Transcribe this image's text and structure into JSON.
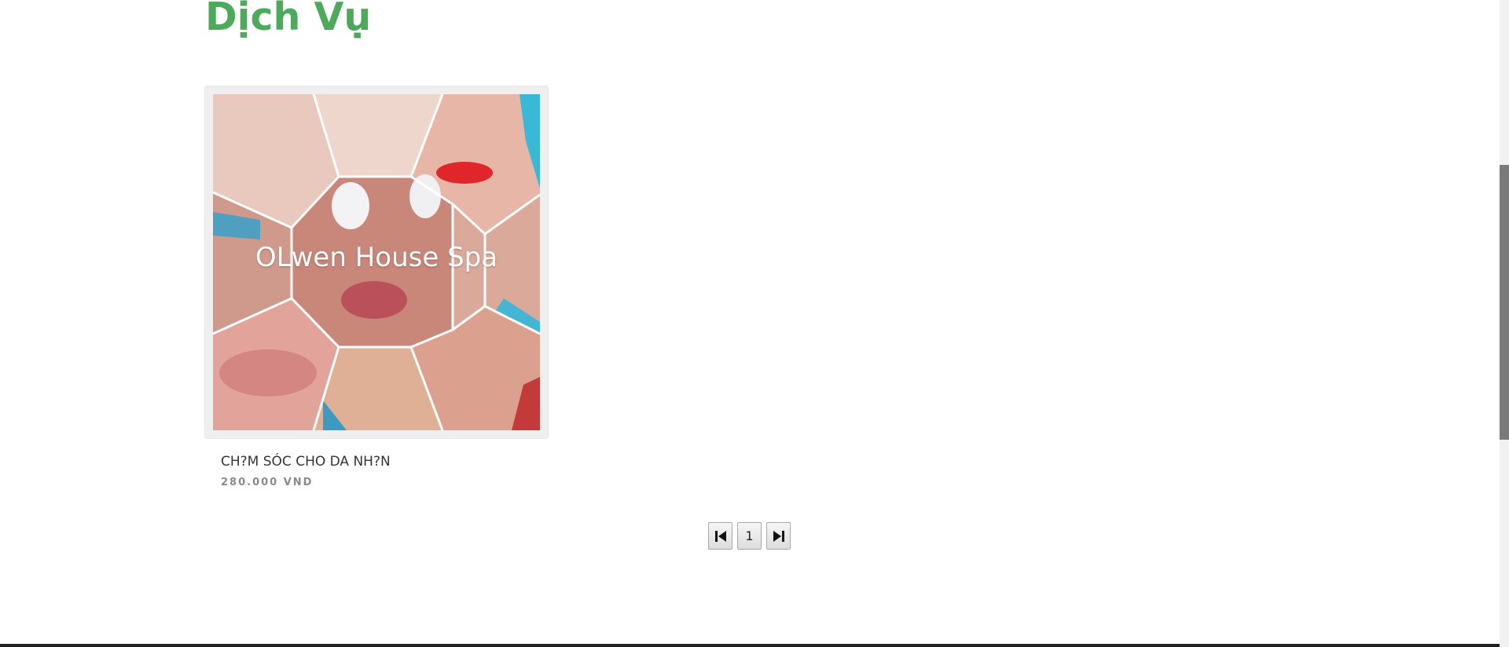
{
  "page": {
    "title": "Dịch Vụ"
  },
  "product": {
    "image_caption": "OLwen House Spa",
    "name": "CH?M SÓC CHO DA NH?N",
    "price": "280.000 VND"
  },
  "pagination": {
    "first_icon": "first-page-icon",
    "current_page": "1",
    "last_icon": "last-page-icon"
  },
  "colors": {
    "title_green": "#4caa5a",
    "name_text": "#33333f",
    "price_text": "#8a8a8a",
    "footer_line": "#222222"
  }
}
